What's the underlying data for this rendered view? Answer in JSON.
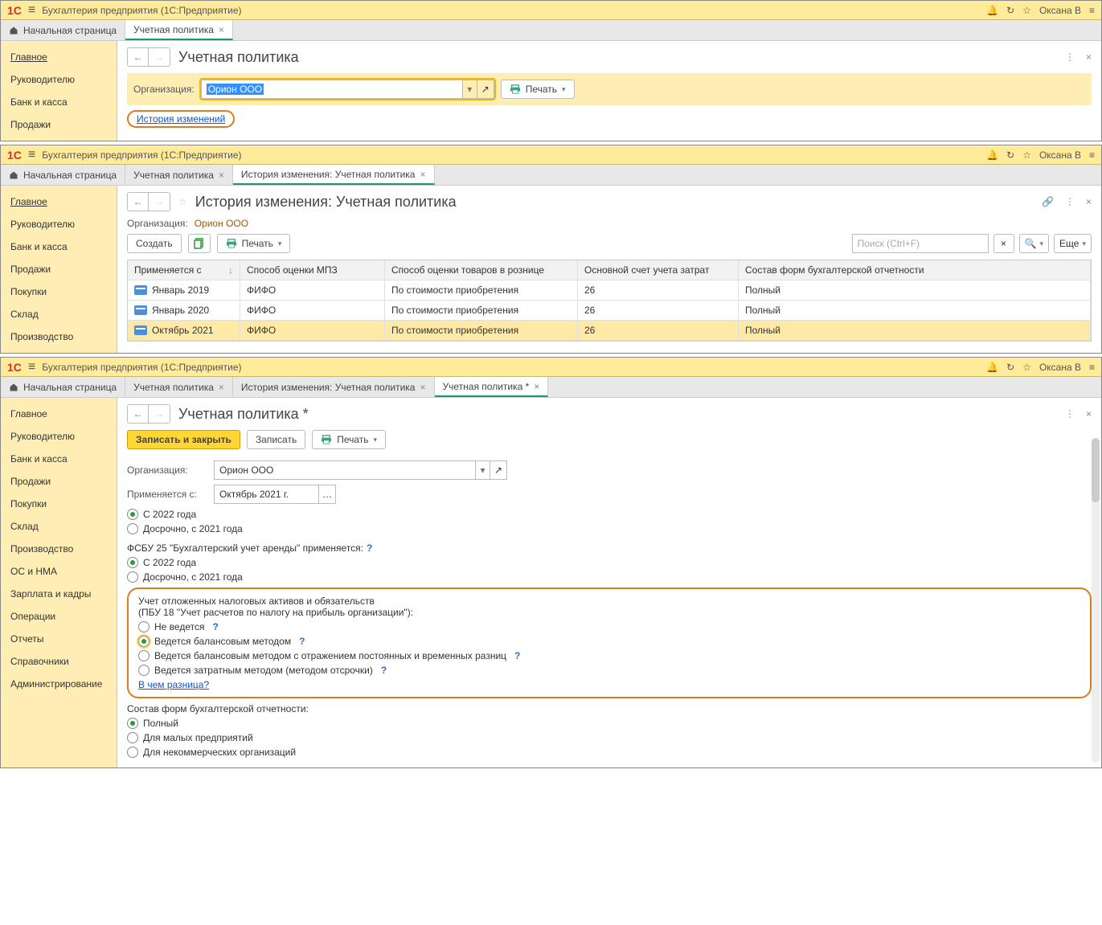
{
  "app": {
    "title": "Бухгалтерия предприятия  (1С:Предприятие)",
    "user": "Оксана В"
  },
  "sidebar": {
    "items": [
      "Главное",
      "Руководителю",
      "Банк и касса",
      "Продажи",
      "Покупки",
      "Склад",
      "Производство",
      "ОС и НМА",
      "Зарплата и кадры",
      "Операции",
      "Отчеты",
      "Справочники",
      "Администрирование"
    ]
  },
  "tabs": {
    "home": "Начальная страница",
    "policy": "Учетная политика",
    "history": "История изменения: Учетная политика",
    "policy_dirty": "Учетная политика *"
  },
  "panel1": {
    "title": "Учетная политика",
    "org_label": "Организация:",
    "org_value": "Орион ООО",
    "print": "Печать",
    "history_link": "История изменений"
  },
  "panel2": {
    "title": "История изменения: Учетная политика",
    "org_label": "Организация:",
    "org_value": "Орион ООО",
    "create": "Создать",
    "print": "Печать",
    "search_ph": "Поиск (Ctrl+F)",
    "more": "Еще",
    "cols": {
      "c1": "Применяется с",
      "c2": "Способ оценки МПЗ",
      "c3": "Способ оценки товаров в рознице",
      "c4": "Основной счет учета затрат",
      "c5": "Состав форм бухгалтерской отчетности"
    },
    "rows": [
      {
        "date": "Январь 2019",
        "mpz": "ФИФО",
        "retail": "По стоимости приобретения",
        "acct": "26",
        "forms": "Полный"
      },
      {
        "date": "Январь 2020",
        "mpz": "ФИФО",
        "retail": "По стоимости приобретения",
        "acct": "26",
        "forms": "Полный"
      },
      {
        "date": "Октябрь 2021",
        "mpz": "ФИФО",
        "retail": "По стоимости приобретения",
        "acct": "26",
        "forms": "Полный"
      }
    ]
  },
  "panel3": {
    "title": "Учетная политика *",
    "save_close": "Записать и закрыть",
    "save": "Записать",
    "print": "Печать",
    "org_label": "Организация:",
    "org_value": "Орион ООО",
    "from_label": "Применяется с:",
    "from_value": "Октябрь 2021 г.",
    "radio_year": {
      "a": "С 2022 года",
      "b": "Досрочно, с 2021 года"
    },
    "fsbu": "ФСБУ 25 \"Бухгалтерский учет аренды\" применяется:",
    "tax_heading1": "Учет отложенных налоговых активов и обязательств",
    "tax_heading2": "(ПБУ 18 \"Учет расчетов по налогу на прибыль организации\"):",
    "tax_opts": {
      "a": "Не ведется",
      "b": "Ведется балансовым методом",
      "c": "Ведется балансовым методом с отражением постоянных и временных разниц",
      "d": "Ведется затратным методом (методом отсрочки)"
    },
    "diff_link": "В чем разница?",
    "forms_label": "Состав форм бухгалтерской отчетности:",
    "forms_opts": {
      "a": "Полный",
      "b": "Для малых предприятий",
      "c": "Для некоммерческих организаций"
    }
  }
}
